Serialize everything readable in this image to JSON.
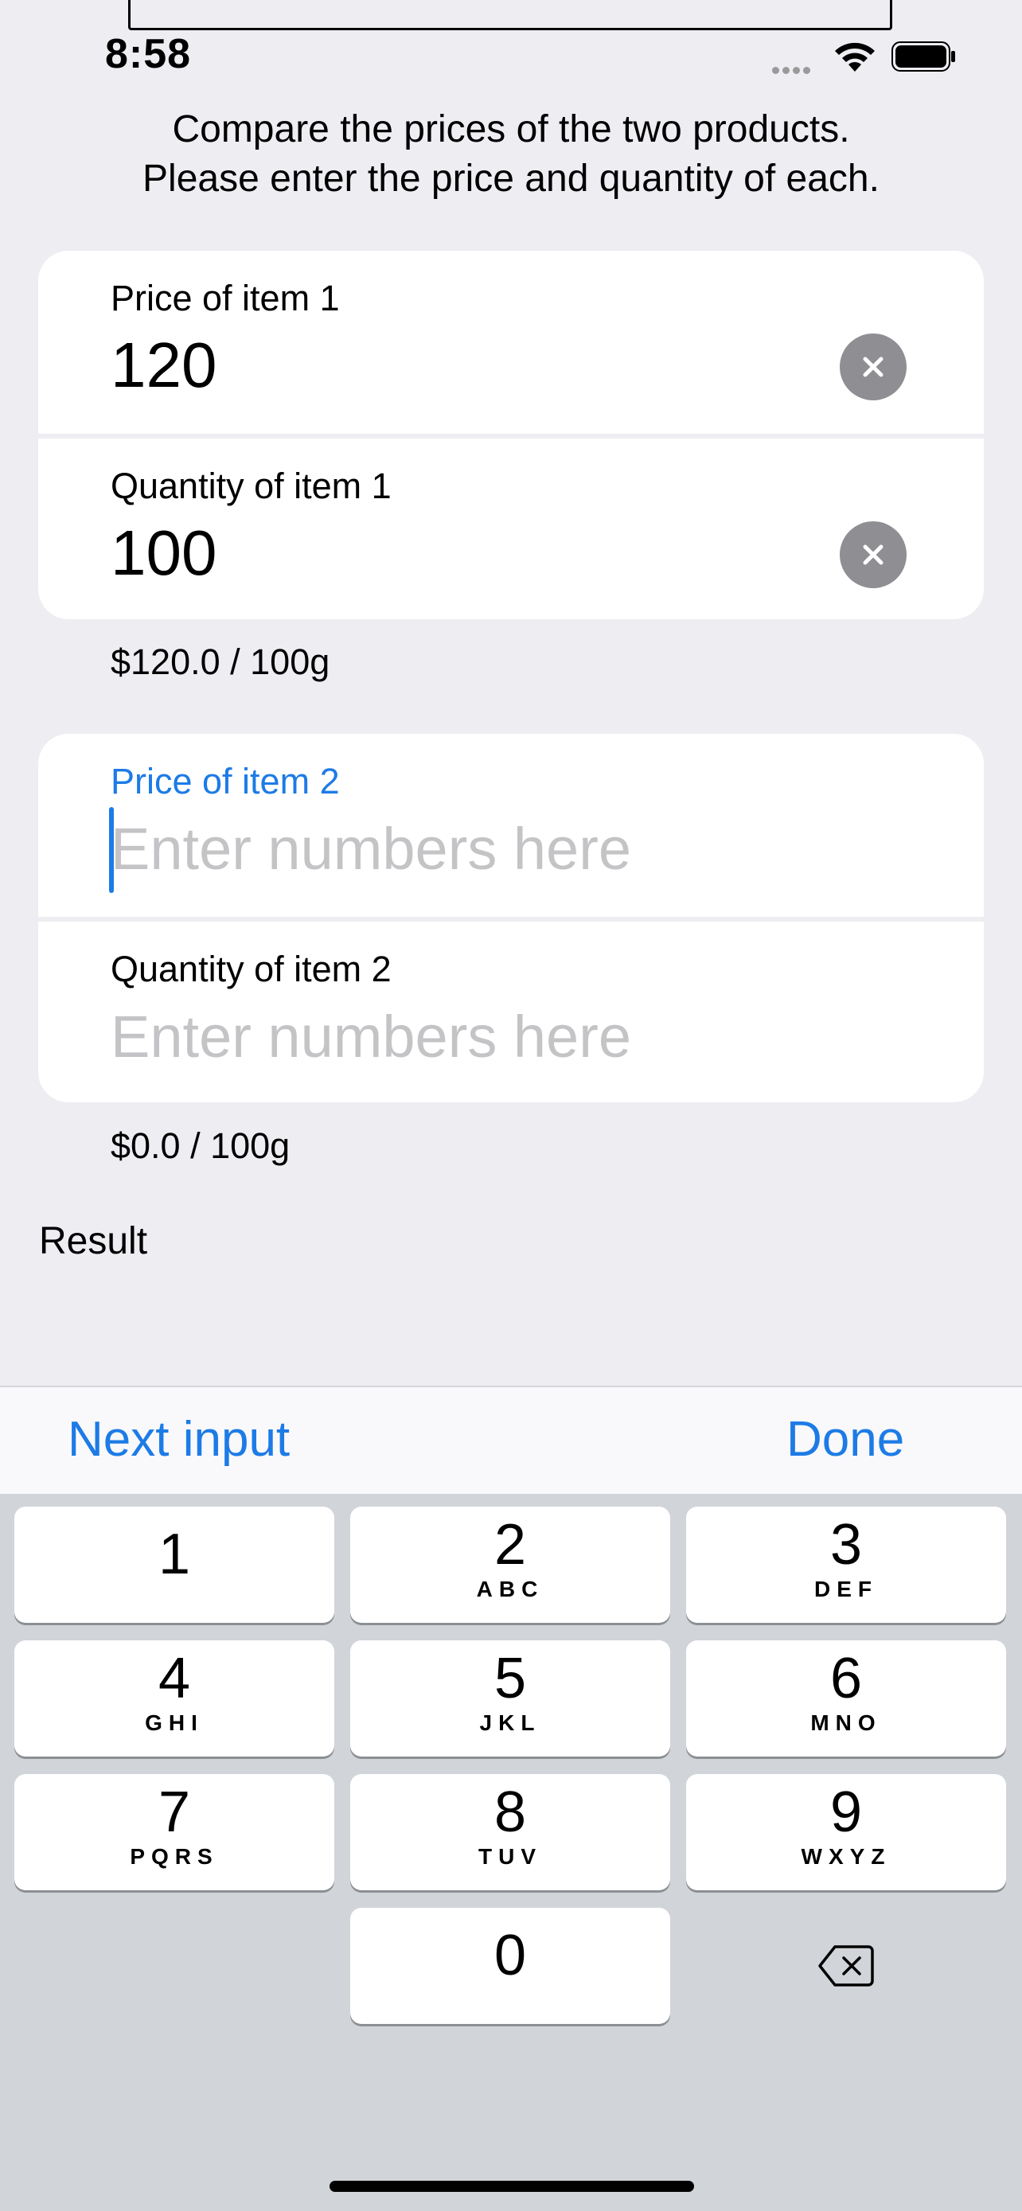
{
  "status_bar": {
    "time": "8:58",
    "signal_icon": "cellular-dots-icon",
    "wifi_icon": "wifi-icon",
    "battery_icon": "battery-icon"
  },
  "instructions": {
    "line1": "Compare the prices of the two products.",
    "line2": "Please enter the price and quantity of each."
  },
  "item1": {
    "price_label": "Price of item 1",
    "price_value": "120",
    "quantity_label": "Quantity of item 1",
    "quantity_value": "100",
    "unit_price": "$120.0 / 100g"
  },
  "item2": {
    "price_label": "Price of item 2",
    "price_placeholder": "Enter numbers here",
    "quantity_label": "Quantity of item 2",
    "quantity_placeholder": "Enter numbers here",
    "unit_price": "$0.0 / 100g"
  },
  "result": {
    "label": "Result"
  },
  "toolbar": {
    "next_label": "Next input",
    "done_label": "Done"
  },
  "keypad": {
    "keys": [
      {
        "digit": "1",
        "letters": ""
      },
      {
        "digit": "2",
        "letters": "ABC"
      },
      {
        "digit": "3",
        "letters": "DEF"
      },
      {
        "digit": "4",
        "letters": "GHI"
      },
      {
        "digit": "5",
        "letters": "JKL"
      },
      {
        "digit": "6",
        "letters": "MNO"
      },
      {
        "digit": "7",
        "letters": "PQRS"
      },
      {
        "digit": "8",
        "letters": "TUV"
      },
      {
        "digit": "9",
        "letters": "WXYZ"
      },
      {
        "digit": "0",
        "letters": ""
      }
    ],
    "delete_icon": "backspace-icon"
  },
  "colors": {
    "accent": "#1D7BE6",
    "background": "#EDEDF2",
    "keyboard_bg": "#D1D4D9",
    "placeholder": "#C4C4C7",
    "clear_button": "#8E8E93"
  }
}
